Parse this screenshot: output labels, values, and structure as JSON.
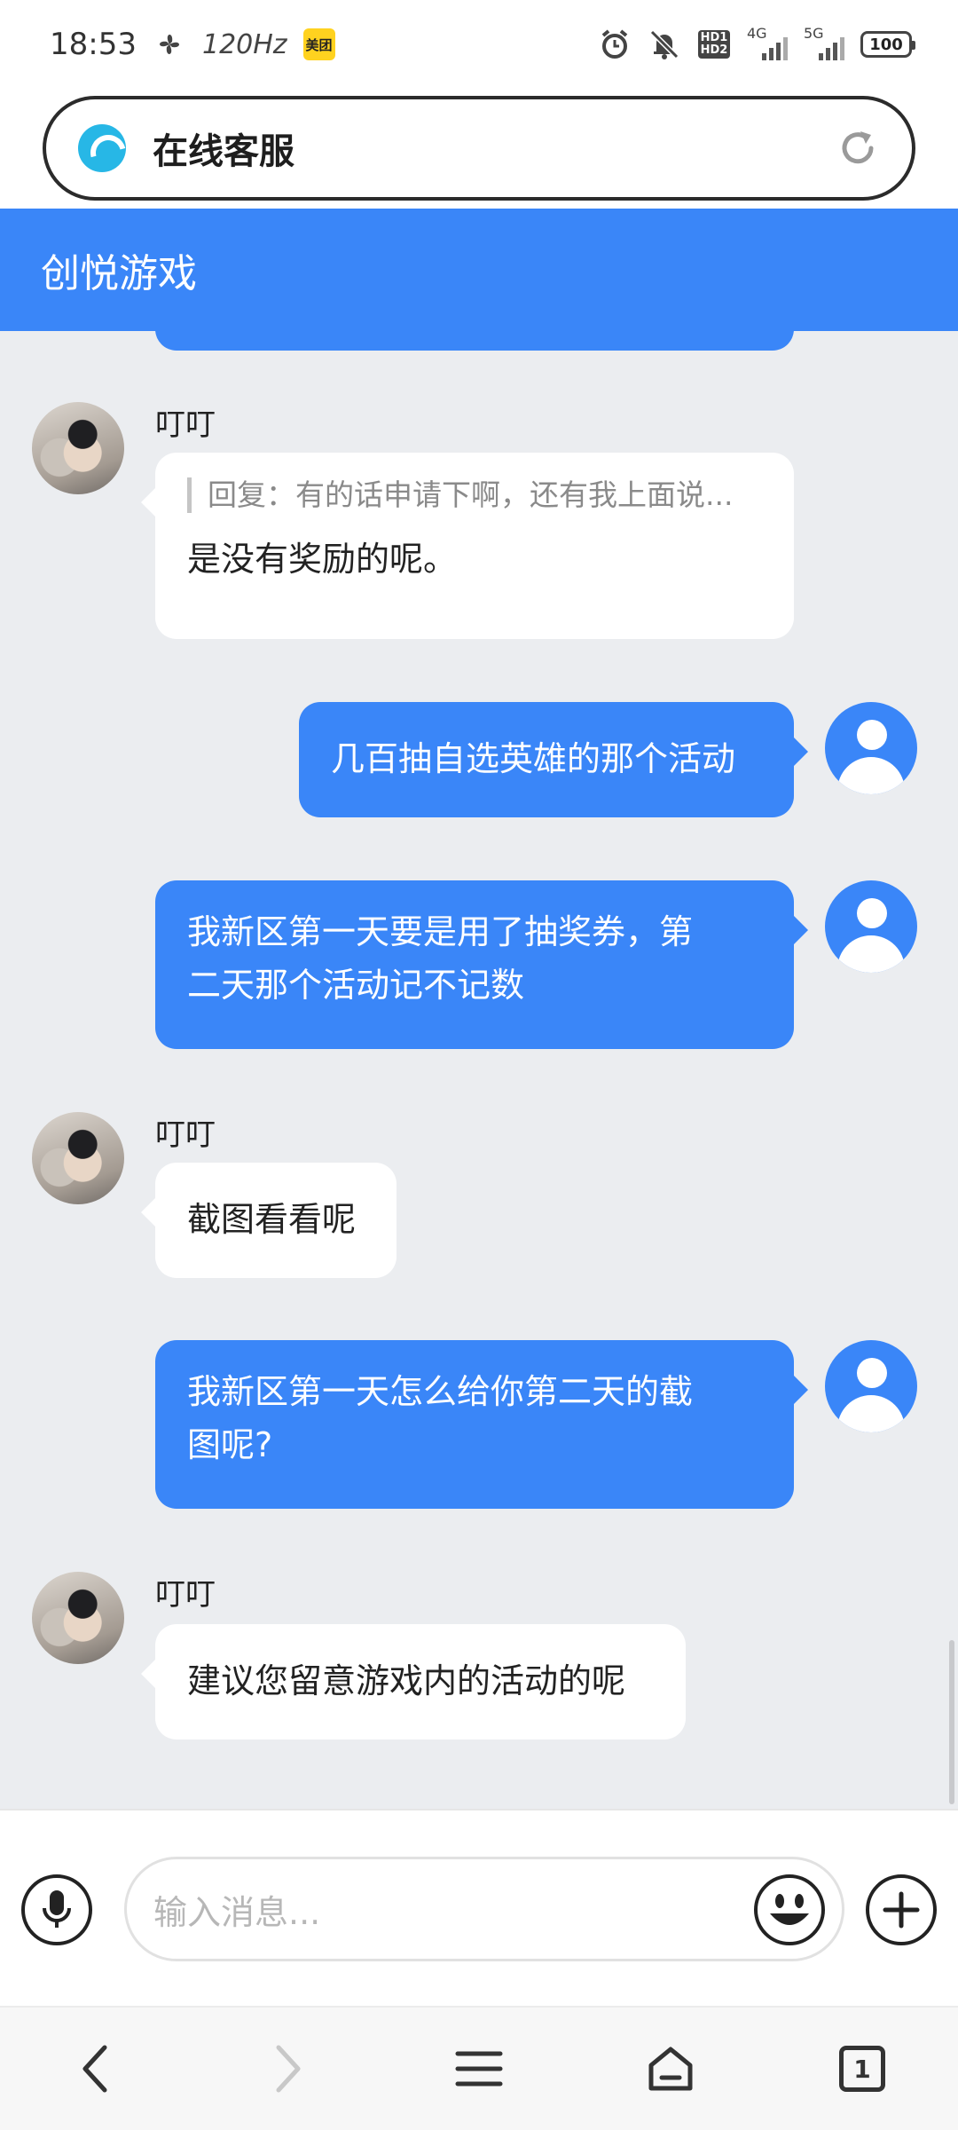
{
  "status_bar": {
    "time": "18:53",
    "refresh_rate": "120Hz",
    "app_badge": "美团",
    "network_1": "4G",
    "network_2": "5G",
    "battery": "100"
  },
  "browser": {
    "page_title": "在线客服"
  },
  "header": {
    "title": "创悦游戏"
  },
  "messages": [
    {
      "side": "left",
      "sender": "叮叮",
      "reply_quote": "回复：有的话申请下啊，还有我上面说...",
      "text": "是没有奖励的呢。"
    },
    {
      "side": "right",
      "text": "几百抽自选英雄的那个活动"
    },
    {
      "side": "right",
      "lines": [
        "我新区第一天要是用了抽奖券，第",
        "二天那个活动记不记数"
      ]
    },
    {
      "side": "left",
      "sender": "叮叮",
      "text": "截图看看呢"
    },
    {
      "side": "right",
      "lines": [
        "我新区第一天怎么给你第二天的截",
        "图呢?"
      ]
    },
    {
      "side": "left",
      "sender": "叮叮",
      "text": "建议您留意游戏内的活动的呢"
    }
  ],
  "input": {
    "placeholder": "输入消息..."
  },
  "bottom_nav": {
    "tab_count": "1"
  },
  "colors": {
    "accent": "#3a86f8",
    "background": "#ebedf0"
  }
}
